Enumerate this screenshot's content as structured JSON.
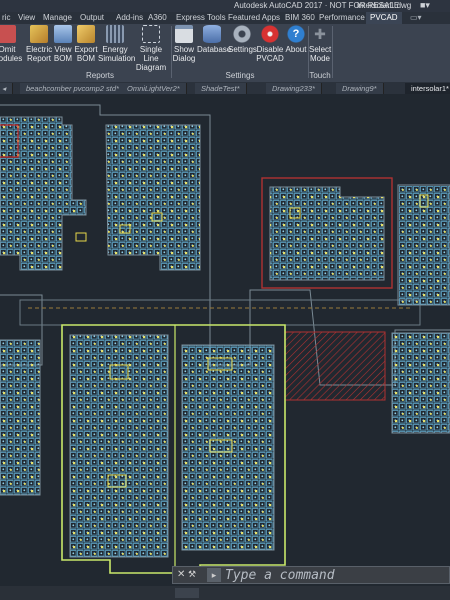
{
  "app": {
    "title": "Autodesk AutoCAD 2017 · NOT FOR RESALE",
    "file": "intersolar1.dwg"
  },
  "menu": [
    "ric",
    "View",
    "Manage",
    "Output",
    "Add-ins",
    "A360",
    "Express Tools",
    "Featured Apps",
    "BIM 360",
    "Performance",
    "PVCAD"
  ],
  "ribbon": {
    "buttons": [
      {
        "l1": "Omit",
        "l2": "Modules",
        "icon": "omit-modules-icon",
        "color": "#c85050"
      },
      {
        "l1": "Electric",
        "l2": "Report",
        "icon": "electric-report-icon",
        "color": "#d8a838"
      },
      {
        "l1": "View",
        "l2": "BOM",
        "icon": "view-bom-icon",
        "color": "#7ea6d8"
      },
      {
        "l1": "Export",
        "l2": "BOM",
        "icon": "export-bom-icon",
        "color": "#e0b050"
      },
      {
        "l1": "Energy",
        "l2": "Simulation",
        "icon": "energy-simulation-icon",
        "color": "#9aa8b8"
      },
      {
        "l1": "Single Line",
        "l2": "Diagram",
        "icon": "single-line-diagram-icon",
        "color": "#cfd6de"
      },
      {
        "l1": "Show",
        "l2": "Dialog",
        "icon": "show-dialog-icon",
        "color": "#d9dde2"
      },
      {
        "l1": "Database",
        "l2": "",
        "icon": "database-icon",
        "color": "#6b8fc8"
      },
      {
        "l1": "Settings",
        "l2": "",
        "icon": "settings-icon",
        "color": "#9ca6b2"
      },
      {
        "l1": "Disable",
        "l2": "PVCAD",
        "icon": "disable-icon",
        "color": "#d83232"
      },
      {
        "l1": "About",
        "l2": "",
        "icon": "about-icon",
        "color": "#2f7fd0"
      },
      {
        "l1": "Select",
        "l2": "Mode",
        "icon": "select-mode-icon",
        "color": "#8a929c"
      }
    ],
    "panels": [
      "Reports",
      "Settings",
      "Touch"
    ]
  },
  "tabs": [
    {
      "label": "beachcomber pvcomp2 std*",
      "active": false
    },
    {
      "label": "OmniLightVer2*",
      "active": false
    },
    {
      "label": "ShadeTest*",
      "active": false
    },
    {
      "label": "Drawing233*",
      "active": false
    },
    {
      "label": "Drawing9*",
      "active": false
    },
    {
      "label": "intersolar1*",
      "active": true
    }
  ],
  "command": {
    "placeholder": "Type a command"
  },
  "colors": {
    "background": "#212830",
    "module": "#5fa6c8",
    "dot": "#e8e26a",
    "selection": "#c9e86a",
    "hatch": "#b03232"
  }
}
